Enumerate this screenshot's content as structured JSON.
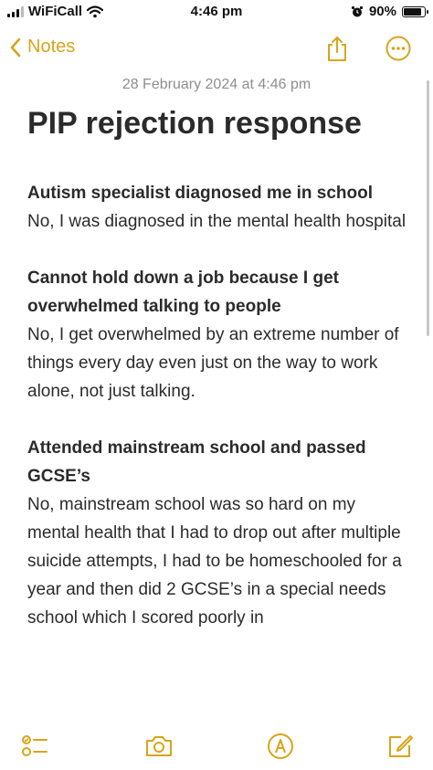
{
  "status_bar": {
    "carrier": "WiFiCall",
    "time": "4:46 pm",
    "battery_percent": "90%",
    "battery_level": 0.9,
    "icons": [
      "signal-icon",
      "wifi-icon",
      "alarm-icon",
      "battery-icon"
    ]
  },
  "nav": {
    "back_label": "Notes",
    "icons": [
      "chevron-left-icon",
      "share-icon",
      "more-icon"
    ],
    "accent_color": "#d7a51a"
  },
  "note": {
    "date": "28 February 2024 at 4:46 pm",
    "title": "PIP rejection response",
    "sections": [
      {
        "question": "Autism specialist diagnosed me in school",
        "answer": "No, I was diagnosed in the mental health hospital"
      },
      {
        "question": "Cannot hold down a job because I get overwhelmed talking to people",
        "answer": "No, I get overwhelmed by an extreme number of things every day even just on the way to work alone, not just talking."
      },
      {
        "question": "Attended mainstream school and passed GCSE’s",
        "answer": "No, mainstream school was so hard on my mental health that I had to drop out after multiple suicide attempts, I had to be homeschooled for a year and then did 2 GCSE’s in a special needs school which I scored poorly in"
      }
    ]
  },
  "toolbar": {
    "icons": [
      "checklist-icon",
      "camera-icon",
      "markup-icon",
      "compose-icon"
    ]
  }
}
